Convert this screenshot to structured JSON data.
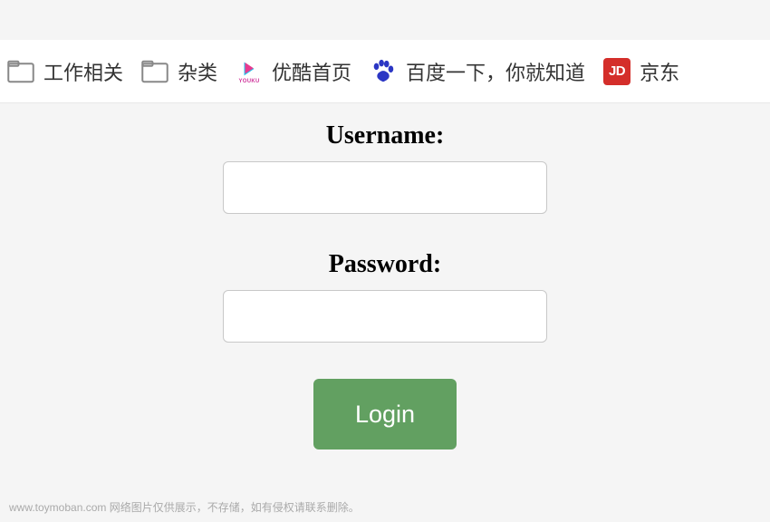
{
  "bookmarks": {
    "work": {
      "label": "工作相关"
    },
    "misc": {
      "label": "杂类"
    },
    "youku": {
      "label": "优酷首页",
      "icon_text": "YOUKU"
    },
    "baidu": {
      "label": "百度一下，你就知道"
    },
    "jd": {
      "label": "京东",
      "icon_text": "JD"
    }
  },
  "form": {
    "username_label": "Username:",
    "password_label": "Password:",
    "username_value": "",
    "password_value": "",
    "login_button": "Login"
  },
  "footer": {
    "text": "www.toymoban.com 网络图片仅供展示，不存储，如有侵权请联系删除。"
  },
  "colors": {
    "button_bg": "#62a061",
    "jd_bg": "#d42e2a",
    "baidu_paw": "#2b36c4"
  }
}
